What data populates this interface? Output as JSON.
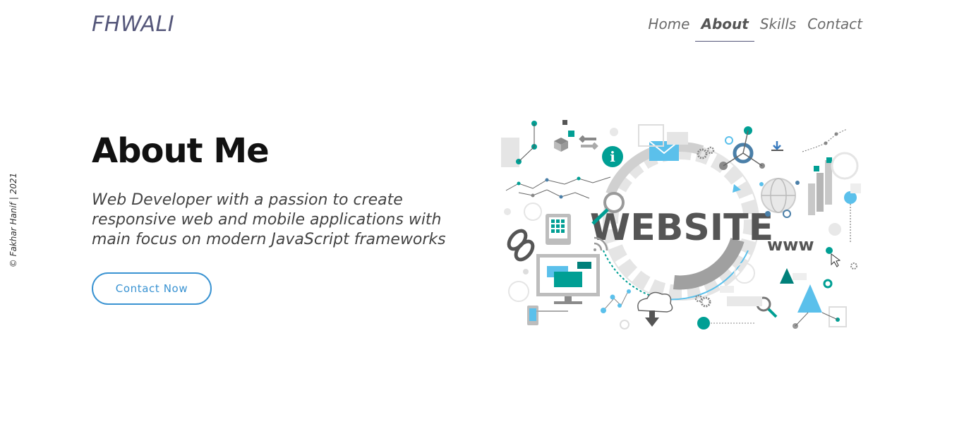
{
  "brand": "FHWALI",
  "nav": [
    "Home",
    "About",
    "Skills",
    "Contact"
  ],
  "active_nav": "About",
  "sidebar_credit": "© Fakhar Hanif | 2021",
  "hero": {
    "title": "About Me",
    "description": "Web Developer with a passion to create responsive web and mobile applications with main focus on modern JavaScript frameworks",
    "cta_label": "Contact Now"
  },
  "illustration": {
    "main_text": "WEBSITE",
    "www_text": "www"
  },
  "colors": {
    "brand": "#55577a",
    "accent": "#3a93d2",
    "teal": "#009f94",
    "light_blue": "#5bc0eb",
    "grey": "#555555"
  }
}
